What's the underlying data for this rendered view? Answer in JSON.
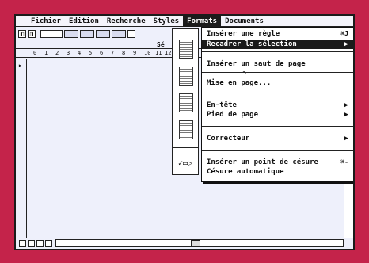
{
  "menubar": {
    "apple": "",
    "items": [
      {
        "label": "Fichier"
      },
      {
        "label": "Edition"
      },
      {
        "label": "Recherche"
      },
      {
        "label": "Styles"
      },
      {
        "label": "Formats"
      },
      {
        "label": "Documents"
      }
    ]
  },
  "rulerbar": {
    "label": "Sé"
  },
  "ruler": {
    "marks": [
      "0",
      "1",
      "2",
      "3",
      "4",
      "5",
      "6",
      "7",
      "8",
      "9",
      "10",
      "11",
      "12"
    ]
  },
  "formats_menu": {
    "items": [
      {
        "label": "Insérer une règle",
        "shortcut": "⌘J",
        "arrow": ""
      },
      {
        "label": "Recadrer la sélection",
        "shortcut": "",
        "arrow": "▶"
      },
      {
        "label": "Insérer un saut de page",
        "shortcut": "",
        "arrow": ""
      },
      {
        "label": "Mise en page...",
        "shortcut": "",
        "arrow": ""
      },
      {
        "label": "En-tête",
        "shortcut": "",
        "arrow": "▶"
      },
      {
        "label": "Pied de page",
        "shortcut": "",
        "arrow": "▶"
      },
      {
        "label": "Correcteur",
        "shortcut": "",
        "arrow": "▶"
      },
      {
        "label": "Insérer un point de césure",
        "shortcut": "⌘-",
        "arrow": ""
      },
      {
        "label": "Césure automatique",
        "shortcut": "",
        "arrow": ""
      }
    ]
  },
  "palette": {
    "pencil": "✓▭▷"
  },
  "toolbar": {
    "btn1": "◧",
    "btn2": "◨"
  },
  "cursor": {
    "marker": "▸"
  }
}
